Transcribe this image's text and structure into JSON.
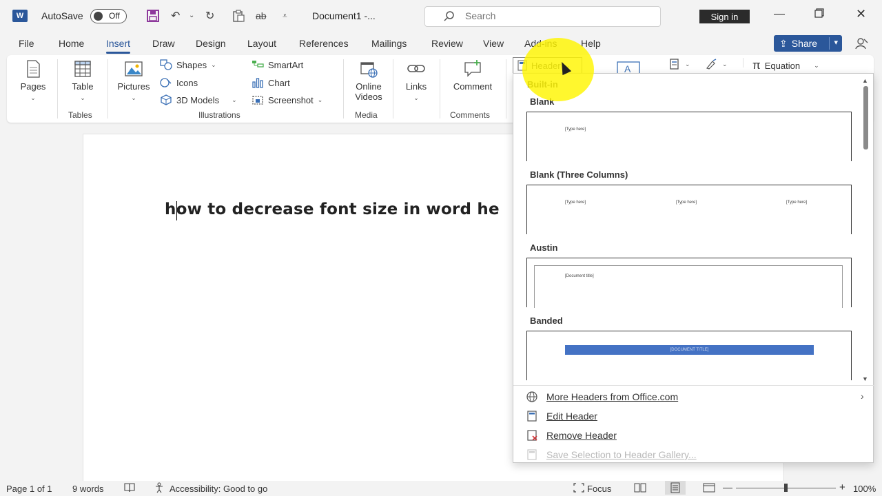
{
  "titlebar": {
    "app_logo": "W",
    "autosave_label": "AutoSave",
    "autosave_state": "Off",
    "doc_title": "Document1  -...",
    "search_placeholder": "Search",
    "signin_label": "Sign in"
  },
  "tabs": [
    "File",
    "Home",
    "Insert",
    "Draw",
    "Design",
    "Layout",
    "References",
    "Mailings",
    "Review",
    "View",
    "Add-ins",
    "Help"
  ],
  "share_label": "Share",
  "ribbon": {
    "pages": "Pages",
    "table": "Table",
    "tables_group": "Tables",
    "pictures": "Pictures",
    "shapes": "Shapes",
    "icons": "Icons",
    "models": "3D Models",
    "smartart": "SmartArt",
    "chart": "Chart",
    "screenshot": "Screenshot",
    "illustrations_group": "Illustrations",
    "online_videos_1": "Online",
    "online_videos_2": "Videos",
    "media_group": "Media",
    "links": "Links",
    "comment": "Comment",
    "comments_group": "Comments",
    "header": "Header",
    "equation": "Equation"
  },
  "document": {
    "text": "how to decrease font size in word he"
  },
  "dropdown": {
    "section": "Built-in",
    "galleries": [
      {
        "label": "Blank",
        "placeholders": [
          "[Type here]"
        ]
      },
      {
        "label": "Blank (Three Columns)",
        "placeholders": [
          "[Type here]",
          "[Type here]",
          "[Type here]"
        ]
      },
      {
        "label": "Austin",
        "placeholders": [
          "[Document title]"
        ]
      },
      {
        "label": "Banded",
        "placeholders": [
          "[DOCUMENT TITLE]"
        ]
      }
    ],
    "more": "More Headers from Office.com",
    "edit": "Edit Header",
    "remove": "Remove Header",
    "save": "Save Selection to Header Gallery..."
  },
  "status": {
    "page": "Page 1 of 1",
    "words": "9 words",
    "accessibility": "Accessibility: Good to go",
    "focus": "Focus",
    "zoom": "100%"
  },
  "colors": {
    "accent": "#2b579a",
    "banded": "#4472c4",
    "highlight": "#fff500"
  }
}
